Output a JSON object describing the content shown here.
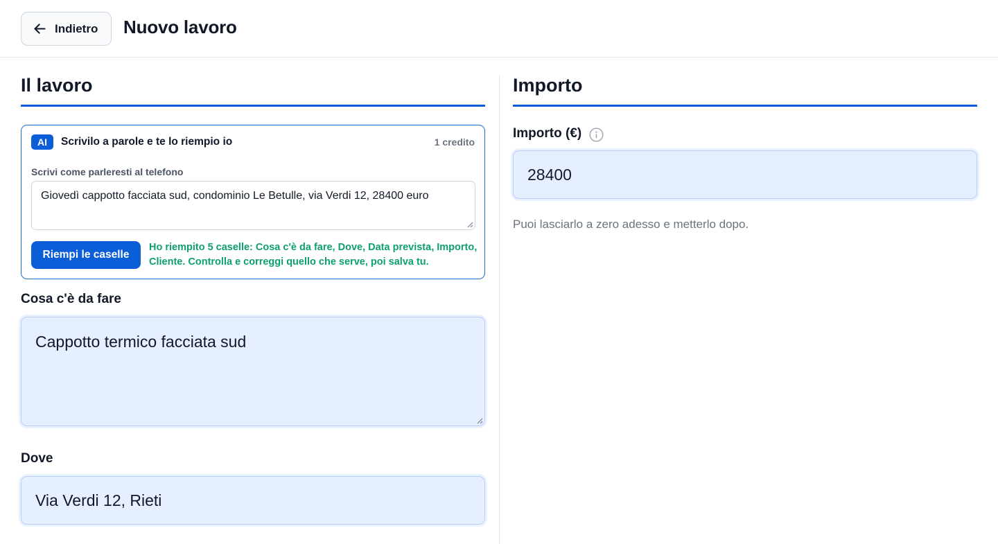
{
  "header": {
    "back_label": "Indietro",
    "title": "Nuovo lavoro"
  },
  "left": {
    "section_title": "Il lavoro",
    "ai_box": {
      "badge": "AI",
      "title": "Scrivilo a parole e te lo riempio io",
      "credits": "1 credito",
      "hint": "Scrivi come parleresti al telefono",
      "input_value": "Giovedì cappotto facciata sud, condominio Le Betulle, via Verdi 12, 28400 euro",
      "fill_button": "Riempi le caselle",
      "status_line1": "Ho riempito 5 caselle: Cosa c'è da fare, Dove, Data prevista, Importo,",
      "status_line2": "Cliente. Controlla e correggi quello che serve, poi salva tu."
    },
    "fields": {
      "task_label": "Cosa c'è da fare",
      "task_value": "Cappotto termico facciata sud",
      "location_label": "Dove",
      "location_value": "Via Verdi 12, Rieti"
    }
  },
  "right": {
    "section_title": "Importo",
    "amount_label": "Importo (€)",
    "amount_value": "28400",
    "helper": "Puoi lasciarlo a zero adesso e metterlo dopo."
  },
  "colors": {
    "accent": "#0b5ed7",
    "field_bg": "#e6efff",
    "success": "#0e9f6e"
  },
  "icons": [
    "arrow-left-icon",
    "info-icon",
    "resize-grip-icon"
  ]
}
